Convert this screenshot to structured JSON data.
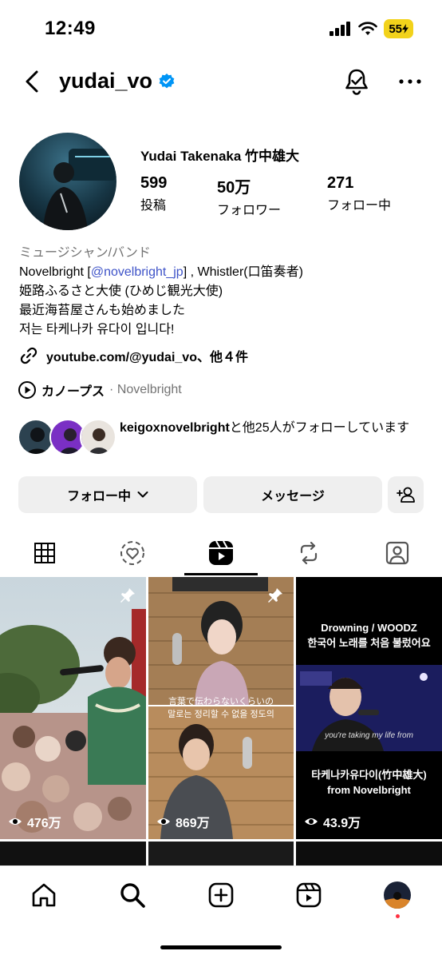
{
  "status": {
    "time": "12:49",
    "battery": "55"
  },
  "nav": {
    "username": "yudai_vo",
    "icons": [
      "back-icon",
      "verified-badge-icon",
      "bell-icon",
      "more-icon"
    ]
  },
  "profile": {
    "full_name": "Yudai Takenaka 竹中雄大",
    "stats": [
      {
        "value": "599",
        "label": "投稿"
      },
      {
        "value": "50万",
        "label": "フォロワー"
      },
      {
        "value": "271",
        "label": "フォロー中"
      }
    ]
  },
  "bio": {
    "category": "ミュージシャン/バンド",
    "line1_prefix": "Novelbright [",
    "line1_mention": "@novelbright_jp",
    "line1_suffix": "] , Whistler(口笛奏者)",
    "line2": "姫路ふるさと大使 (ひめじ観光大使)",
    "line3": "最近海苔屋さんも始めました",
    "line4": "저는 타케나카 유다이 입니다!",
    "link": "youtube.com/@yudai_vo、他４件",
    "music_song": "カノープス",
    "music_artist": "· Novelbright"
  },
  "followed_by": {
    "name": "keigoxnovelbright",
    "rest": "と他25人がフォローしています"
  },
  "buttons": {
    "following": "フォロー中",
    "message": "メッセージ"
  },
  "tabs": [
    "grid-icon",
    "reels-like-icon",
    "reels-icon",
    "reposts-icon",
    "tagged-icon"
  ],
  "grid": [
    {
      "views": "476万",
      "pinned": true,
      "caption": ""
    },
    {
      "views": "869万",
      "pinned": true,
      "caption_line1": "言葉で伝わらないくらいの",
      "caption_line2": "말로는 정리할 수 없을 정도의"
    },
    {
      "views": "43.9万",
      "pinned": false,
      "title_line1": "Drowning / WOODZ",
      "title_line2": "한국어 노래를 처음 불렀어요",
      "footer_line1": "타케나카유다이(竹中雄大)",
      "footer_line2": "from Novelbright",
      "subtitle": "you're taking my life from"
    }
  ],
  "colors": {
    "accent": "#3e53c8",
    "verified": "#0095f6",
    "button_bg": "#efefef",
    "notify": "#ff3040"
  }
}
